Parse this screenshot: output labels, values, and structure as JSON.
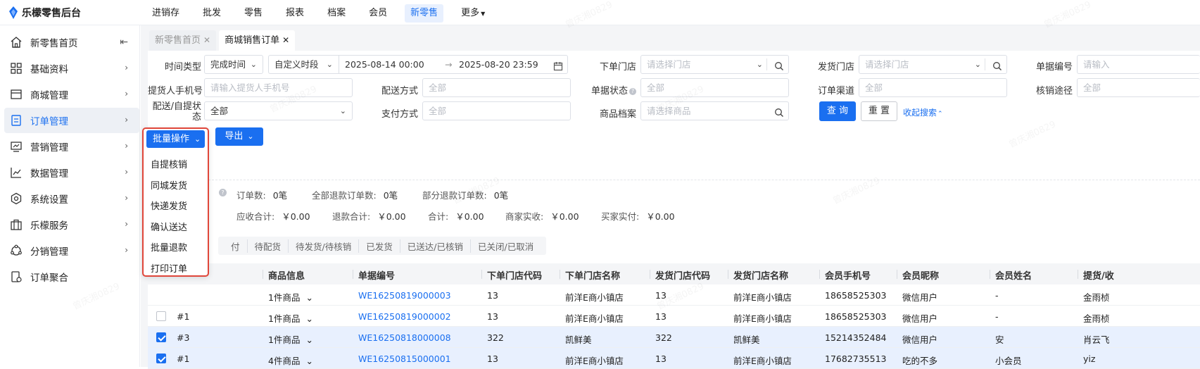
{
  "app": {
    "title": "乐檬零售后台"
  },
  "topnav": [
    "进销存",
    "批发",
    "零售",
    "报表",
    "档案",
    "会员",
    "新零售",
    "更多"
  ],
  "topnav_active": 6,
  "sidebar": [
    {
      "label": "新零售首页",
      "icon": "home-icon"
    },
    {
      "label": "基础资料",
      "icon": "grid-icon"
    },
    {
      "label": "商城管理",
      "icon": "store-icon"
    },
    {
      "label": "订单管理",
      "icon": "order-list-icon"
    },
    {
      "label": "营销管理",
      "icon": "marketing-icon"
    },
    {
      "label": "数据管理",
      "icon": "chart-line-icon"
    },
    {
      "label": "系统设置",
      "icon": "settings-icon"
    },
    {
      "label": "乐檬服务",
      "icon": "briefcase-icon"
    },
    {
      "label": "分销管理",
      "icon": "distribution-icon"
    },
    {
      "label": "订单聚合",
      "icon": "aggregate-icon"
    }
  ],
  "sidebar_active": 3,
  "tabs": [
    {
      "label": "新零售首页"
    },
    {
      "label": "商城销售订单"
    }
  ],
  "filters": {
    "time_type_label": "时间类型",
    "time_type_value": "完成时间",
    "period_value": "自定义时段",
    "date_start": "2025-08-14 00:00",
    "date_arrow": "→",
    "date_end": "2025-08-20 23:59",
    "order_store_label": "下单门店",
    "order_store_ph": "请选择门店",
    "ship_store_label": "发货门店",
    "ship_store_ph": "请选择门店",
    "doc_no_label": "单据编号",
    "doc_no_ph": "请输入",
    "pickup_phone_label": "提货人手机号",
    "pickup_phone_ph": "请输入提货人手机号",
    "delivery_method_label": "配送方式",
    "delivery_method_value": "全部",
    "doc_status_label": "单据状态",
    "doc_status_value": "全部",
    "order_channel_label": "订单渠道",
    "order_channel_value": "全部",
    "writeoff_label": "核销途径",
    "writeoff_value": "全部",
    "delivery_status_label": "配送/自提状态",
    "delivery_status_value": "全部",
    "payment_label": "支付方式",
    "payment_value": "全部",
    "product_label": "商品档案",
    "product_ph": "请选择商品",
    "query_btn": "查 询",
    "reset_btn": "重 置",
    "collapse_link": "收起搜索"
  },
  "actions": {
    "batch": "批量操作",
    "export": "导出"
  },
  "batch_menu": [
    "自提核销",
    "同城发货",
    "快递发货",
    "确认送达",
    "批量退款",
    "打印订单"
  ],
  "stats": {
    "order_count_label": "订单数:",
    "order_count": "0笔",
    "full_refund_label": "全部退款订单数:",
    "full_refund": "0笔",
    "partial_refund_label": "部分退款订单数:",
    "partial_refund": "0笔",
    "receivable_label": "应收合计:",
    "receivable": "￥0.00",
    "refund_total_label": "退款合计:",
    "refund_total": "￥0.00",
    "total_label": "合计:",
    "total": "￥0.00",
    "merchant_label": "商家实收:",
    "merchant": "￥0.00",
    "buyer_label": "买家实付:",
    "buyer": "￥0.00"
  },
  "status_tabs": [
    "付",
    "待配货",
    "待发货/待核销",
    "已发货",
    "已送达/已核销",
    "已关闭/已取消"
  ],
  "table": {
    "headers": [
      "商品信息",
      "单据编号",
      "下单门店代码",
      "下单门店名称",
      "发货门店代码",
      "发货门店名称",
      "会员手机号",
      "会员昵称",
      "会员姓名",
      "提货/收"
    ],
    "rows": [
      {
        "checked": false,
        "seq": "",
        "goods": "1件商品",
        "doc": "WE16250819000003",
        "ocode": "13",
        "oname": "前洋E商小镇店",
        "scode": "13",
        "sname": "前洋E商小镇店",
        "phone": "18658525303",
        "nick": "微信用户",
        "name": "-",
        "pickup": "金雨桢"
      },
      {
        "checked": false,
        "seq": "#1",
        "goods": "1件商品",
        "doc": "WE16250819000002",
        "ocode": "13",
        "oname": "前洋E商小镇店",
        "scode": "13",
        "sname": "前洋E商小镇店",
        "phone": "18658525303",
        "nick": "微信用户",
        "name": "-",
        "pickup": "金雨桢"
      },
      {
        "checked": true,
        "seq": "#3",
        "goods": "1件商品",
        "doc": "WE16250818000008",
        "ocode": "322",
        "oname": "凯鲜美",
        "scode": "322",
        "sname": "凯鲜美",
        "phone": "15214352484",
        "nick": "微信用户",
        "name": "安",
        "pickup": "肖云飞"
      },
      {
        "checked": true,
        "seq": "#1",
        "goods": "4件商品",
        "doc": "WE16250815000001",
        "ocode": "13",
        "oname": "前洋E商小镇店",
        "scode": "13",
        "sname": "前洋E商小镇店",
        "phone": "17682735513",
        "nick": "吃的不多",
        "name": "小会员",
        "pickup": "yiz"
      }
    ]
  },
  "watermark": "曾庆湘0829",
  "colors": {
    "accent": "#1a6ff0",
    "highlight_border": "#e0463a",
    "selected_row": "#e8f0fe"
  }
}
